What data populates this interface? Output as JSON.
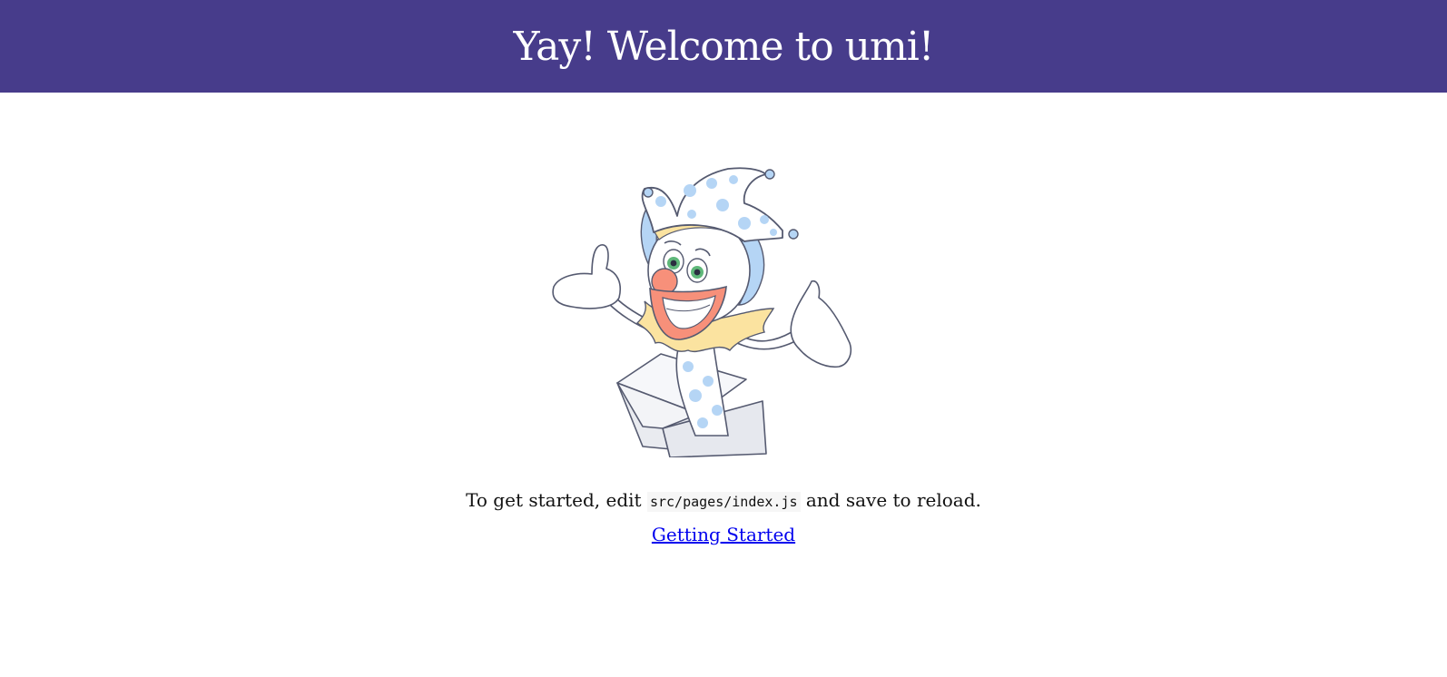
{
  "header": {
    "title": "Yay! Welcome to umi!",
    "background_color": "#473c8b"
  },
  "illustration": {
    "icon": "jester-clown-in-box-illustration"
  },
  "main": {
    "intro_prefix": "To get started, edit ",
    "intro_code": "src/pages/index.js",
    "intro_suffix": " and save to reload.",
    "link_label": "Getting Started",
    "link_color": "#0000ee"
  }
}
